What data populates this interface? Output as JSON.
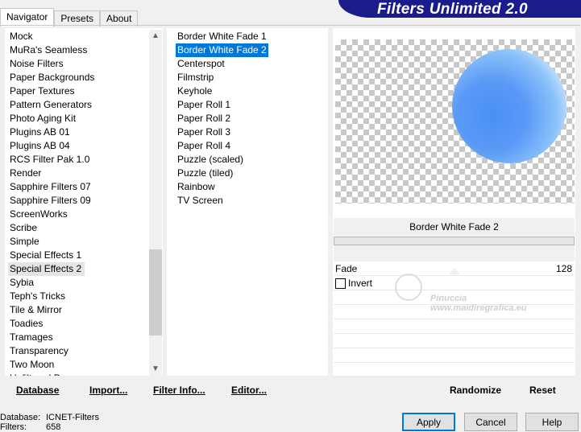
{
  "tabs": [
    "Navigator",
    "Presets",
    "About"
  ],
  "app_title": "Filters Unlimited 2.0",
  "categories": [
    "Mock",
    "MuRa's Seamless",
    "Noise Filters",
    "Paper Backgrounds",
    "Paper Textures",
    "Pattern Generators",
    "Photo Aging Kit",
    "Plugins AB 01",
    "Plugins AB 04",
    "RCS Filter Pak 1.0",
    "Render",
    "Sapphire Filters 07",
    "Sapphire Filters 09",
    "ScreenWorks",
    "Scribe",
    "Simple",
    "Special Effects 1",
    "Special Effects 2",
    "Sybia",
    "Teph's Tricks",
    "Tile & Mirror",
    "Toadies",
    "Tramages",
    "Transparency",
    "Two Moon",
    "Unfiltered Ps..."
  ],
  "selected_category": "Special Effects 2",
  "filters": [
    "Border White Fade 1",
    "Border White Fade 2",
    "Centerspot",
    "Filmstrip",
    "Keyhole",
    "Paper Roll 1",
    "Paper Roll 2",
    "Paper Roll 3",
    "Paper Roll 4",
    "Puzzle (scaled)",
    "Puzzle (tiled)",
    "Rainbow",
    "TV Screen"
  ],
  "selected_filter": "Border White Fade 2",
  "preview": {
    "filter_name": "Border White Fade 2"
  },
  "params": {
    "fade_label": "Fade",
    "fade_value": "128",
    "invert_label": "Invert",
    "invert_checked": false
  },
  "watermark": {
    "line1": "Pinuccia",
    "line2": "www.maidiregrafica.eu"
  },
  "bottom_buttons": {
    "database": "Database",
    "import": "Import...",
    "filter_info": "Filter Info...",
    "editor": "Editor...",
    "randomize": "Randomize",
    "reset": "Reset"
  },
  "status": {
    "database_label": "Database:",
    "database_value": "ICNET-Filters",
    "filters_label": "Filters:",
    "filters_value": "658"
  },
  "dialog_buttons": {
    "apply": "Apply",
    "cancel": "Cancel",
    "help": "Help"
  }
}
